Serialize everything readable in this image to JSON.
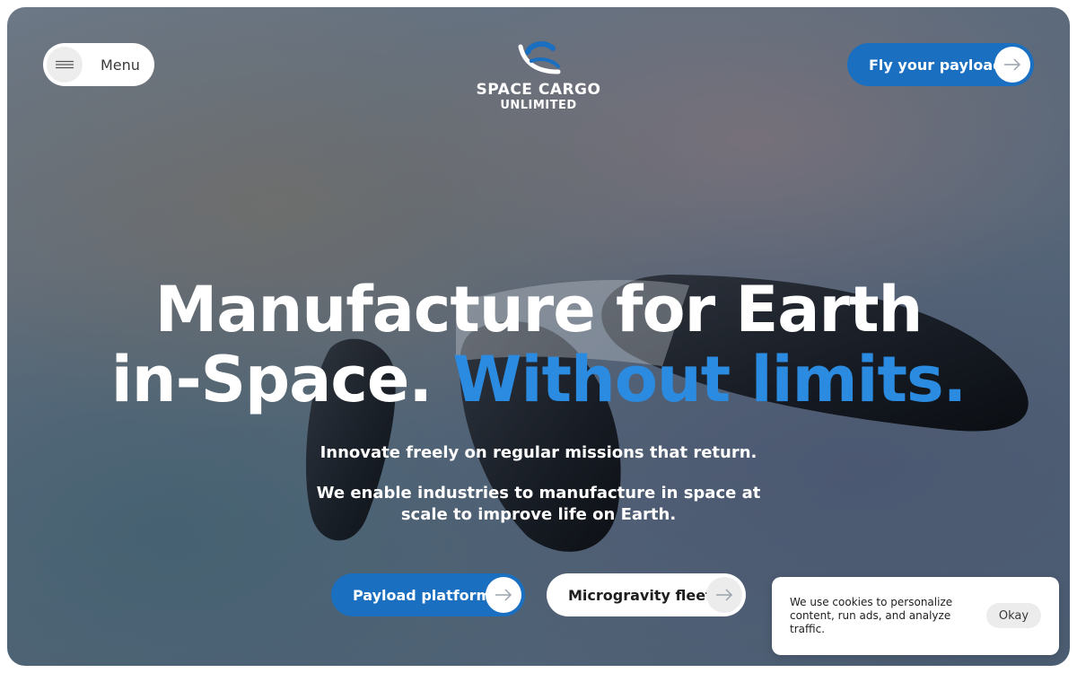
{
  "header": {
    "menu_label": "Menu",
    "logo_line1": "SPACE CARGO",
    "logo_line2": "UNLIMITED",
    "cta_label": "Fly your payload"
  },
  "hero": {
    "headline_line1": "Manufacture for Earth",
    "headline_line2_start": "in-Space. ",
    "headline_line2_accent": "Without limits.",
    "subtitle": "Innovate freely on regular missions that return.",
    "description": "We enable industries to manufacture in space at scale to improve life on Earth.",
    "primary_button": "Payload platform",
    "secondary_button": "Microgravity fleet"
  },
  "cookie_banner": {
    "text": "We use cookies to personalize content, run ads, and analyze traffic.",
    "button": "Okay"
  },
  "colors": {
    "accent": "#2b8be0",
    "button_blue": "#1a6fc0"
  },
  "icons": [
    "hamburger-icon",
    "arrow-right-icon",
    "logo-orbit-icon"
  ]
}
